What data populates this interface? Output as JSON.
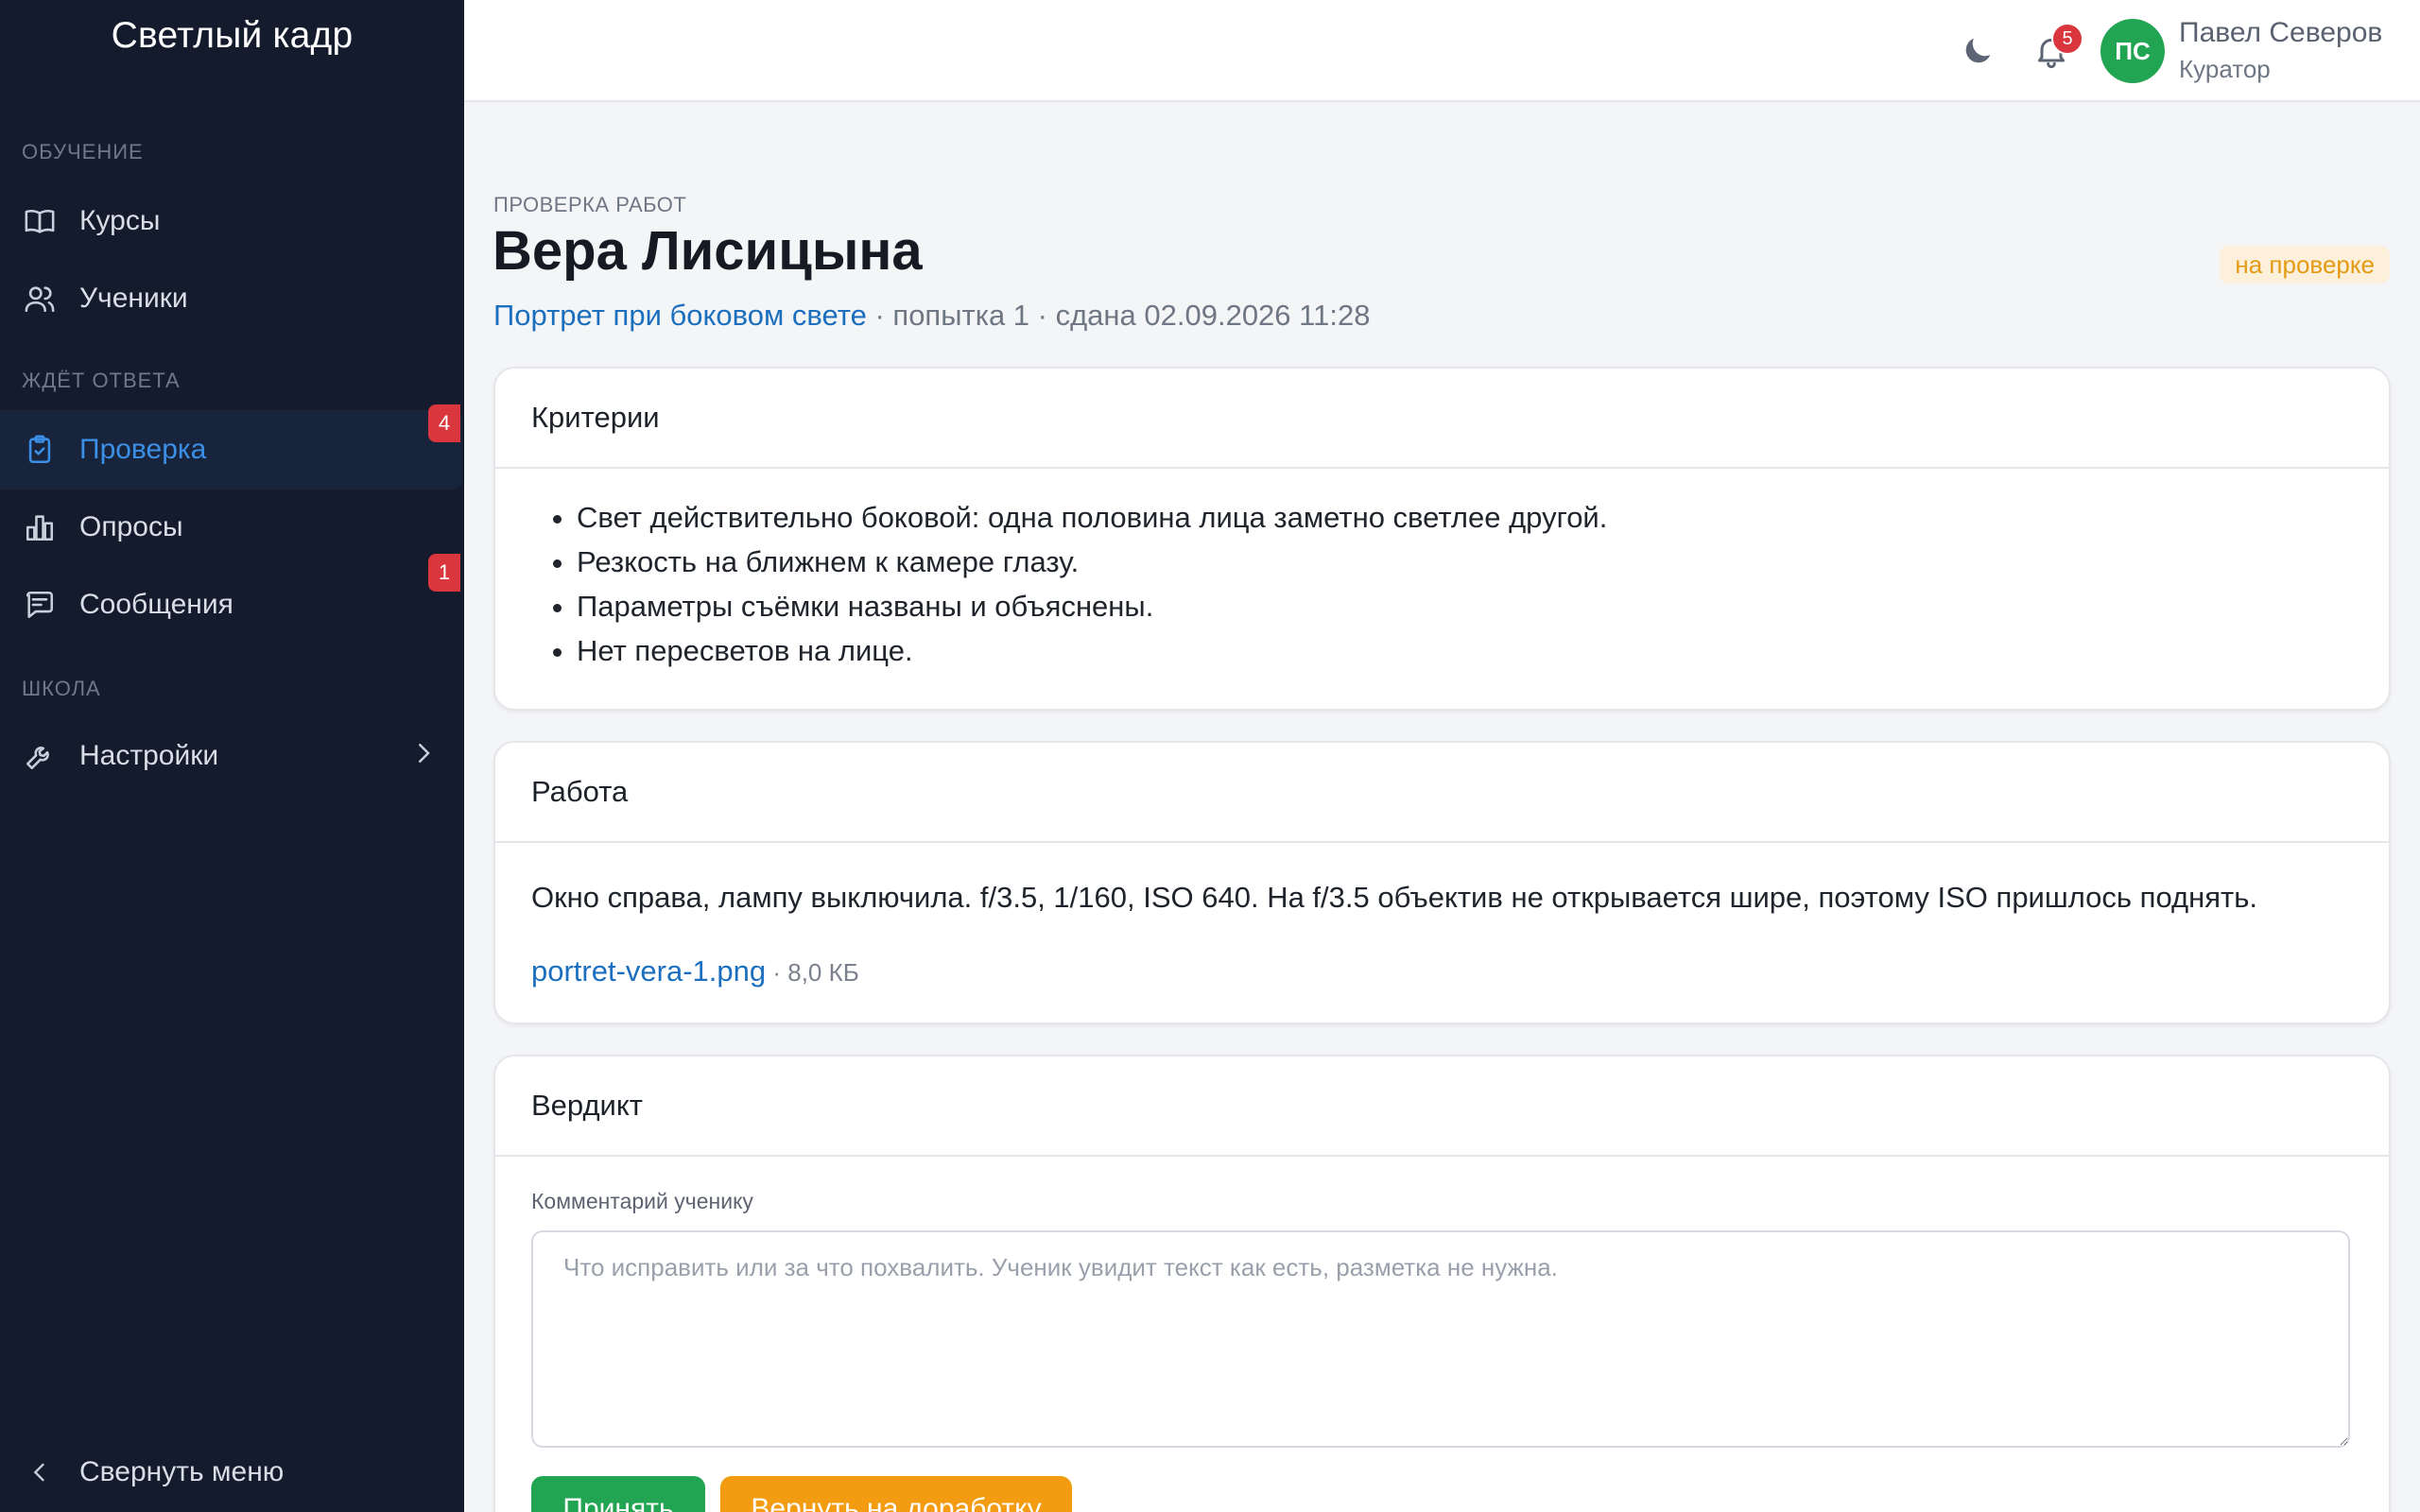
{
  "sidebar": {
    "brand": "Светлый кадр",
    "sections": [
      {
        "label": "ОБУЧЕНИЕ"
      },
      {
        "label": "ЖДЁТ ОТВЕТА"
      },
      {
        "label": "ШКОЛА"
      }
    ],
    "items": [
      {
        "label": "Курсы",
        "icon": "book-icon"
      },
      {
        "label": "Ученики",
        "icon": "users-icon"
      },
      {
        "label": "Проверка",
        "icon": "clipboard-check-icon",
        "badge": "4",
        "active": true
      },
      {
        "label": "Опросы",
        "icon": "bar-chart-icon"
      },
      {
        "label": "Сообщения",
        "icon": "message-icon",
        "badge": "1"
      },
      {
        "label": "Настройки",
        "icon": "wrench-icon"
      }
    ],
    "collapse_label": "Свернуть меню"
  },
  "header": {
    "notifications_count": "5",
    "user": {
      "initials": "ПС",
      "name": "Павел Северов",
      "role": "Куратор"
    }
  },
  "page": {
    "breadcrumb": "ПРОВЕРКА РАБОТ",
    "title": "Вера Лисицына",
    "status": "на проверке",
    "assignment_link": "Портрет при боковом свете",
    "meta_rest": " · попытка 1 · сдана 02.09.2026 11:28"
  },
  "criteria": {
    "title": "Критерии",
    "items": [
      "Свет действительно боковой: одна половина лица заметно светлее другой.",
      "Резкость на ближнем к камере глазу.",
      "Параметры съёмки названы и объяснены.",
      "Нет пересветов на лице."
    ]
  },
  "work": {
    "title": "Работа",
    "text": "Окно справа, лампу выключила. f/3.5, 1/160, ISO 640. На f/3.5 объектив не открывается шире, поэтому ISO пришлось поднять.",
    "file_name": "portret-vera-1.png",
    "file_size": " · 8,0 КБ"
  },
  "verdict": {
    "title": "Вердикт",
    "comment_label": "Комментарий ученику",
    "comment_placeholder": "Что исправить или за что похвалить. Ученик увидит текст как есть, разметка не нужна.",
    "accept_label": "Принять",
    "return_label": "Вернуть на доработку"
  },
  "colors": {
    "sidebar_bg": "#141b2d",
    "accent": "#3b8fe6",
    "link": "#1b6fbe",
    "badge_red": "#d9363e",
    "success": "#22a552",
    "warning": "#f39c12"
  }
}
